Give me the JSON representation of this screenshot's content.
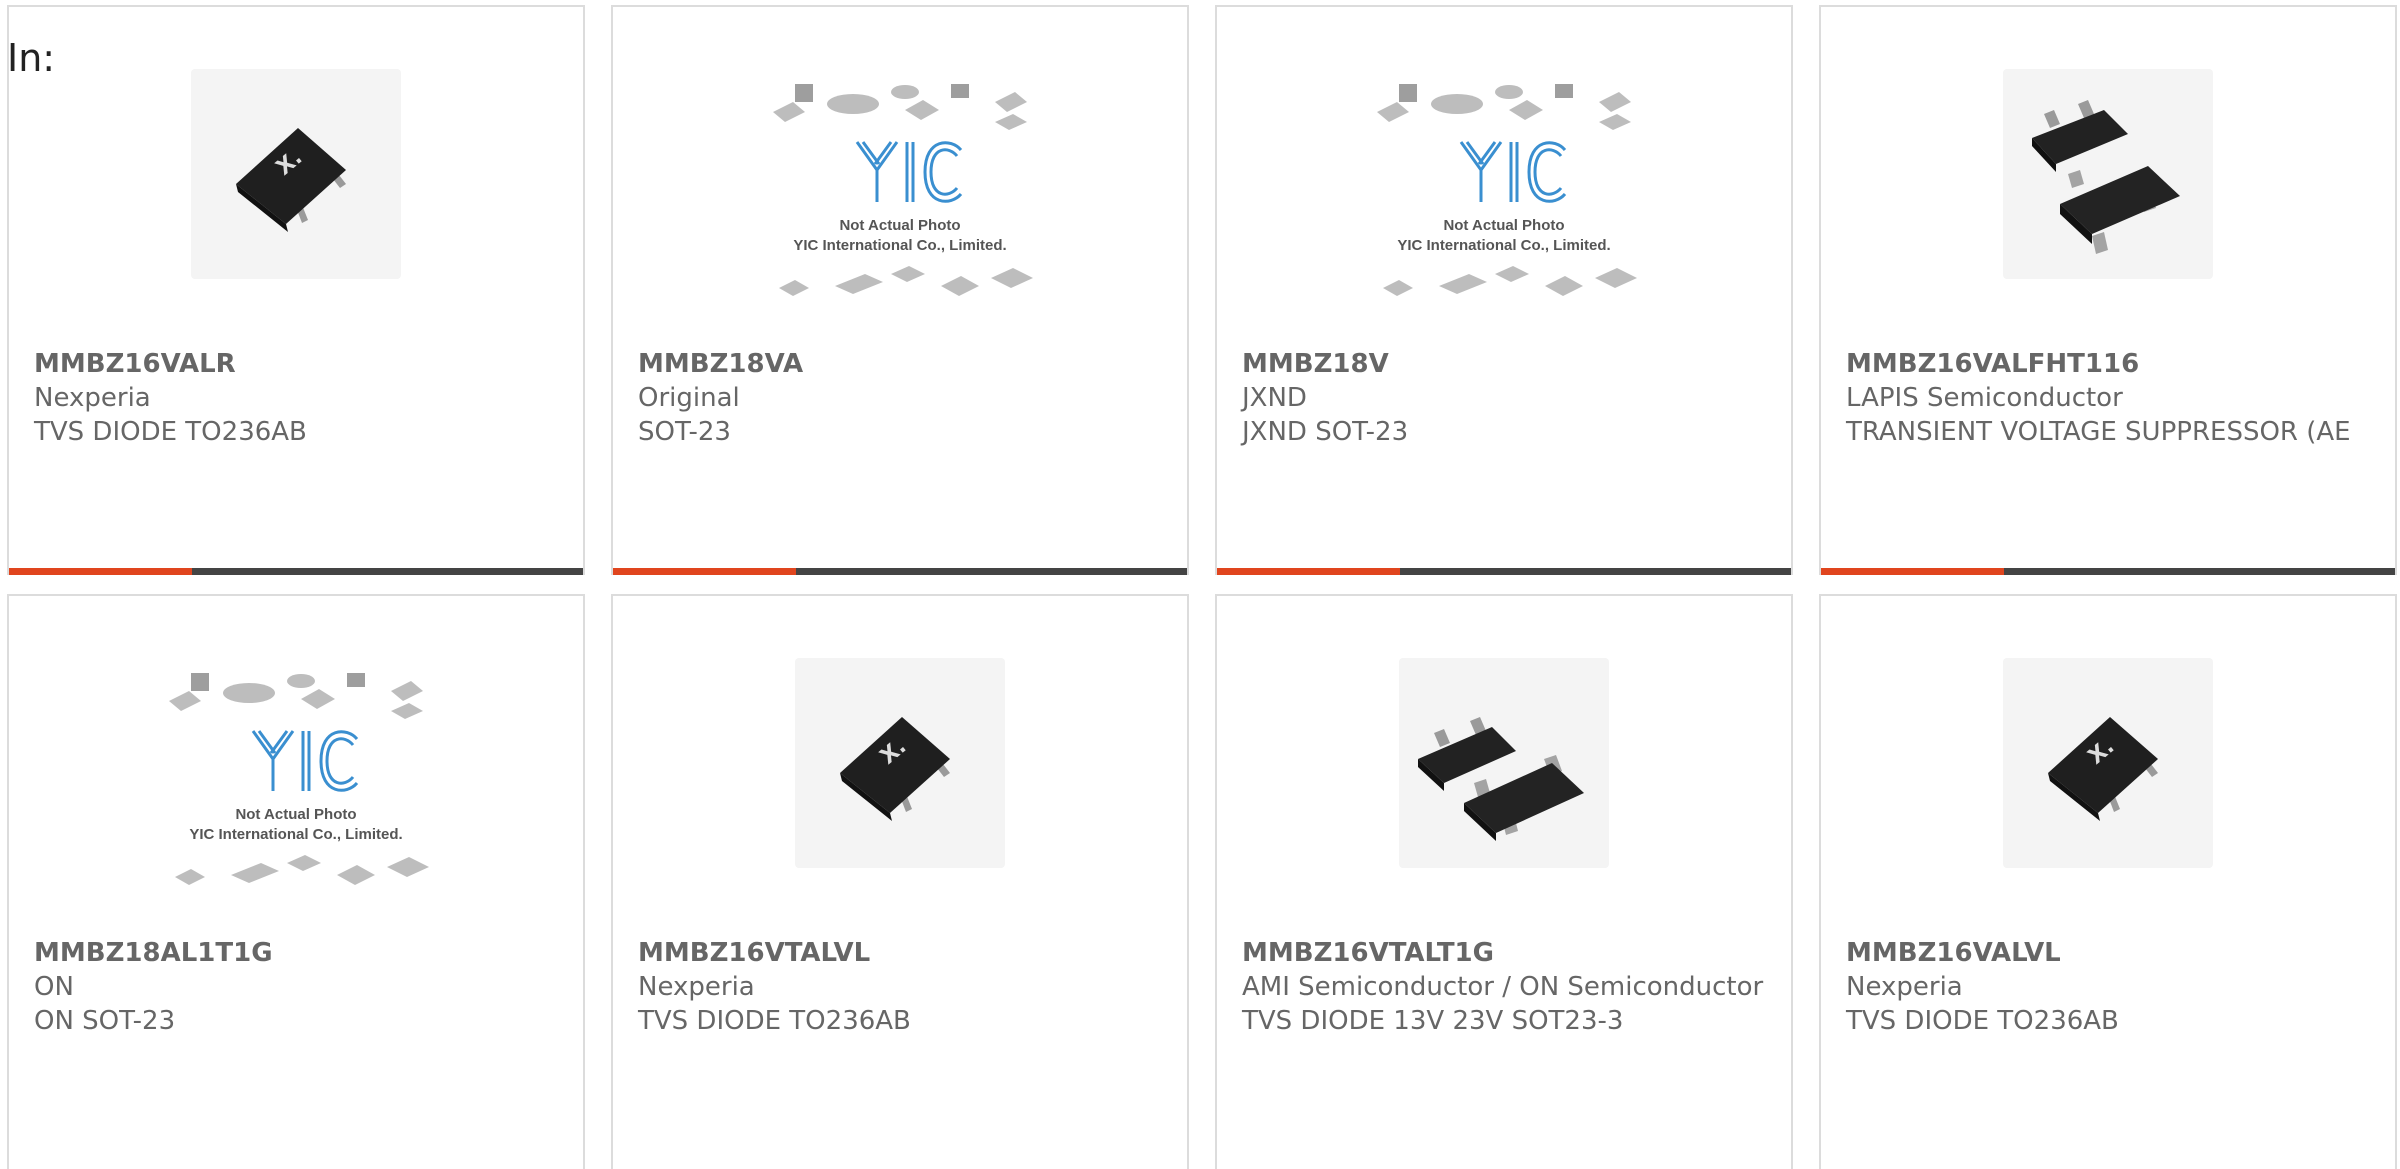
{
  "page": {
    "in_label": "In:"
  },
  "placeholder": {
    "line1": "Not Actual Photo",
    "line2": "YIC International Co., Limited."
  },
  "products": [
    {
      "part": "MMBZ16VALR",
      "manufacturer": "Nexperia",
      "description": "TVS DIODE TO236AB",
      "image": "sot23-nexperia-chip-icon"
    },
    {
      "part": "MMBZ18VA",
      "manufacturer": "Original",
      "description": "SOT-23",
      "image": "yic-placeholder-icon"
    },
    {
      "part": "MMBZ18V",
      "manufacturer": "JXND",
      "description": "JXND SOT-23",
      "image": "yic-placeholder-icon"
    },
    {
      "part": "MMBZ16VALFHT116",
      "manufacturer": "LAPIS Semiconductor",
      "description": "TRANSIENT VOLTAGE SUPPRESSOR (AE",
      "image": "sot23-pair-chip-icon"
    },
    {
      "part": "MMBZ18AL1T1G",
      "manufacturer": "ON",
      "description": "ON SOT-23",
      "image": "yic-placeholder-icon"
    },
    {
      "part": "MMBZ16VTALVL",
      "manufacturer": "Nexperia",
      "description": "TVS DIODE TO236AB",
      "image": "sot23-nexperia-chip-icon"
    },
    {
      "part": "MMBZ16VTALT1G",
      "manufacturer": "AMI Semiconductor / ON Semiconductor",
      "description": "TVS DIODE 13V 23V SOT23-3",
      "image": "sot23-pair-chip-icon"
    },
    {
      "part": "MMBZ16VALVL",
      "manufacturer": "Nexperia",
      "description": "TVS DIODE TO236AB",
      "image": "sot23-nexperia-chip-icon"
    }
  ],
  "colors": {
    "accent": "#e0451e",
    "bar": "#444444",
    "text": "#666666",
    "logo": "#3a8fd0"
  }
}
